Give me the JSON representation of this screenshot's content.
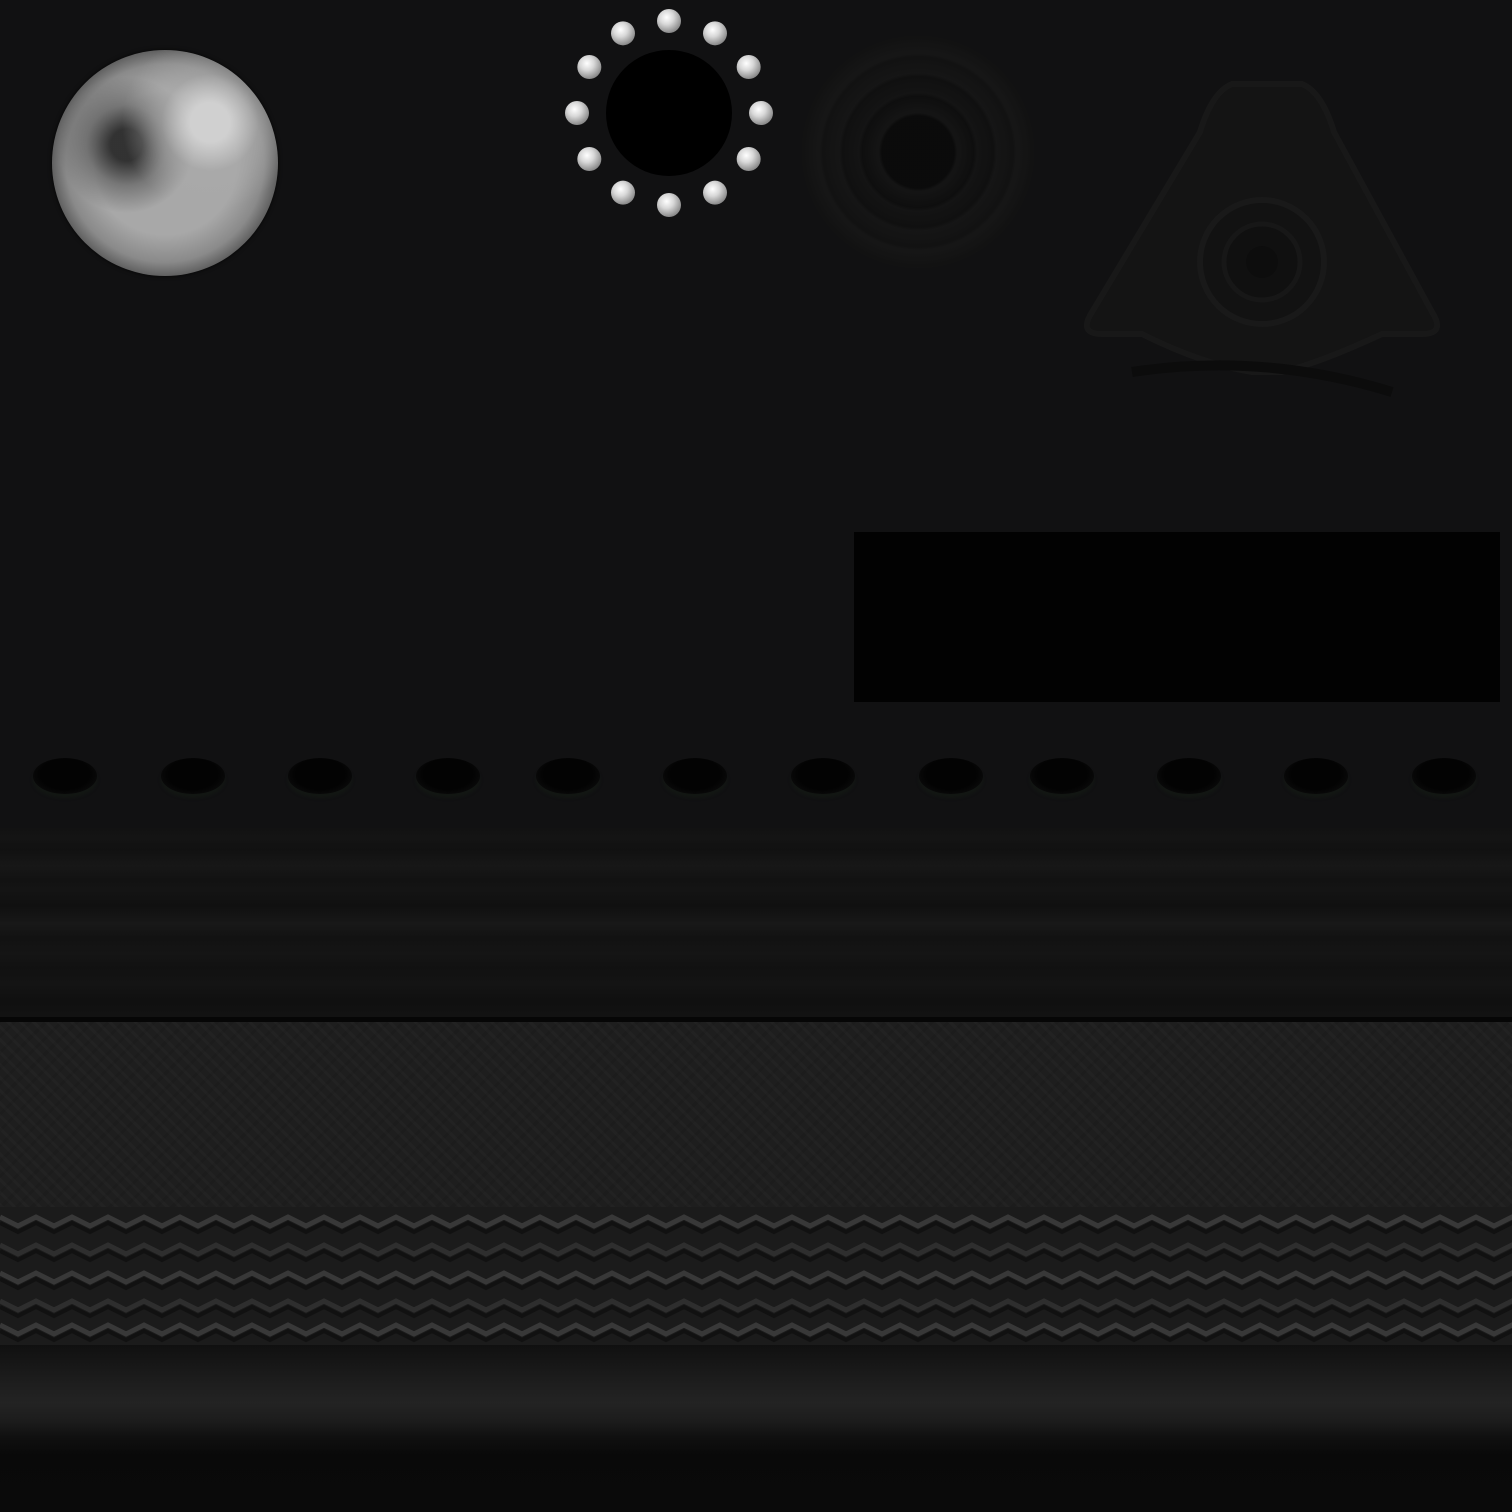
{
  "scene": {
    "background_color": "#111112",
    "sphere_color": "#a8a8a8",
    "pearl_color": "#e6e6e6",
    "panel_color": "#020202",
    "band_color": "#1e1e1e",
    "pearl_count": 12,
    "hole_count": 12
  }
}
